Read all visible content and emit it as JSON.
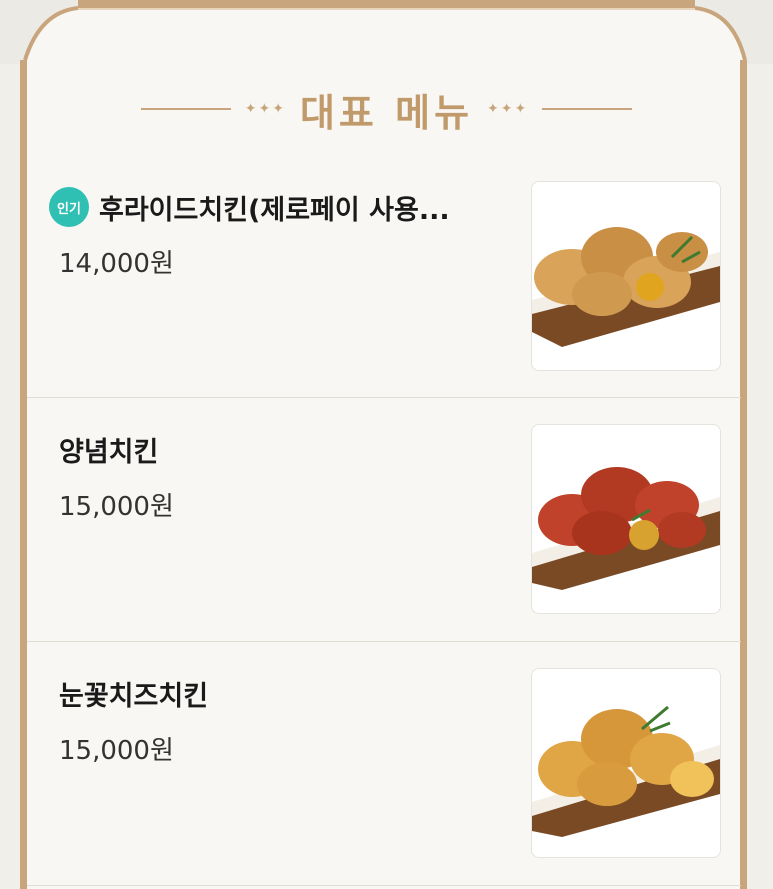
{
  "section": {
    "title": "대표 메뉴",
    "ornament_left": "✦✦✦",
    "ornament_right": "✦✦✦"
  },
  "menu_items": [
    {
      "badge": "인기",
      "name": "후라이드치킨(제로페이 사용...",
      "price": "14,000원",
      "image_icon": "fried-chicken-icon",
      "chicken_color": "#d9a35a"
    },
    {
      "name": "양념치킨",
      "price": "15,000원",
      "image_icon": "seasoned-chicken-icon",
      "chicken_color": "#c0422a"
    },
    {
      "name": "눈꽃치즈치킨",
      "price": "15,000원",
      "image_icon": "cheese-chicken-icon",
      "chicken_color": "#e0a545"
    }
  ],
  "colors": {
    "accent_gold": "#c8a57c",
    "badge_teal": "#2fbfb3"
  }
}
